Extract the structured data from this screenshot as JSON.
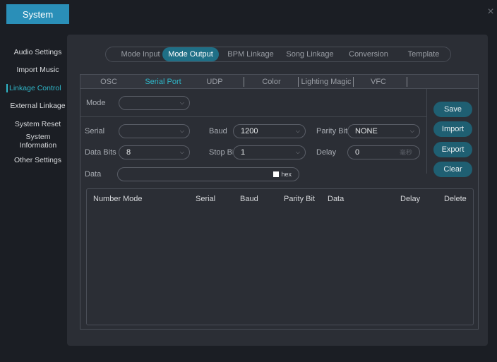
{
  "app": {
    "system_tab": "System",
    "close_glyph": "×"
  },
  "sidebar": {
    "items": [
      {
        "label": "Audio Settings"
      },
      {
        "label": "Import Music"
      },
      {
        "label": "Linkage Control"
      },
      {
        "label": "External Linkage"
      },
      {
        "label": "System Reset"
      },
      {
        "label": "System Information"
      },
      {
        "label": "Other Settings"
      }
    ],
    "active_index": 2
  },
  "top_tabs": [
    {
      "label": "Mode Input"
    },
    {
      "label": "Mode Output"
    },
    {
      "label": "BPM Linkage"
    },
    {
      "label": "Song Linkage"
    },
    {
      "label": "Conversion"
    },
    {
      "label": "Template"
    }
  ],
  "sub_tabs": [
    {
      "label": "OSC"
    },
    {
      "label": "Serial Port"
    },
    {
      "label": "UDP"
    },
    {
      "label": "Color"
    },
    {
      "label": "Lighting Magic"
    },
    {
      "label": "VFC"
    }
  ],
  "form": {
    "mode_label": "Mode",
    "mode_value": "",
    "serial_label": "Serial",
    "serial_value": "",
    "baud_label": "Baud",
    "baud_value": "1200",
    "parity_label": "Parity Bit",
    "parity_value": "NONE",
    "data_bits_label": "Data Bits",
    "data_bits_value": "8",
    "stop_bit_label": "Stop Bit",
    "stop_bit_value": "1",
    "delay_label": "Delay",
    "delay_value": "0",
    "delay_unit": "毫秒",
    "data_label": "Data",
    "data_value": "",
    "hex_label": "hex"
  },
  "actions": {
    "save": "Save",
    "import": "Import",
    "export": "Export",
    "clear": "Clear"
  },
  "table": {
    "columns": [
      "Number",
      "Mode",
      "Serial",
      "Baud",
      "Parity Bit",
      "Data",
      "Delay",
      "Delete"
    ],
    "rows": []
  },
  "colors": {
    "accent": "#2fb6c8",
    "active_tab_bg": "#1f6f86",
    "system_tab_bg": "#2a8fb8",
    "button_bg": "#1f5f72"
  }
}
